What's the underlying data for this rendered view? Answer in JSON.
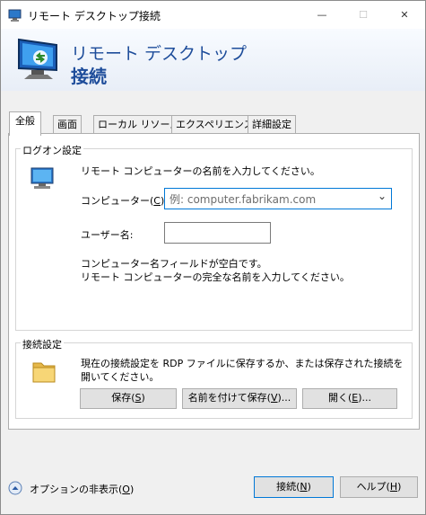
{
  "window": {
    "title": "リモート デスクトップ接続",
    "minimize_icon": "—",
    "maximize_icon": "☐",
    "close_icon": "✕"
  },
  "banner": {
    "line1": "リモート デスクトップ",
    "line2": "接続"
  },
  "tabs": [
    {
      "label": "全般",
      "selected": true
    },
    {
      "label": "画面",
      "selected": false
    },
    {
      "label": "ローカル リソース",
      "selected": false
    },
    {
      "label": "エクスペリエンス",
      "selected": false
    },
    {
      "label": "詳細設定",
      "selected": false
    }
  ],
  "logon": {
    "group_label": "ログオン設定",
    "instruction": "リモート コンピューターの名前を入力してください。",
    "computer_label_pre": "コンピューター(",
    "computer_label_key": "C",
    "computer_label_post": "):",
    "computer_placeholder": "例: computer.fabrikam.com",
    "computer_value": "",
    "username_label": "ユーザー名:",
    "username_value": "",
    "hint_line1": "コンピューター名フィールドが空白です。",
    "hint_line2": "リモート コンピューターの完全な名前を入力してください。"
  },
  "connection": {
    "group_label": "接続設定",
    "description_line1": "現在の接続設定を RDP ファイルに保存するか、または保存された接続を",
    "description_line2": "開いてください。",
    "save_pre": "保存(",
    "save_key": "S",
    "save_post": ")",
    "save_as_pre": "名前を付けて保存(",
    "save_as_key": "V",
    "save_as_post": ")...",
    "open_pre": "開く(",
    "open_key": "E",
    "open_post": ")..."
  },
  "footer": {
    "options_pre": "オプションの非表示(",
    "options_key": "O",
    "options_post": ")",
    "connect_pre": "接続(",
    "connect_key": "N",
    "connect_post": ")",
    "help_pre": "ヘルプ(",
    "help_key": "H",
    "help_post": ")"
  }
}
